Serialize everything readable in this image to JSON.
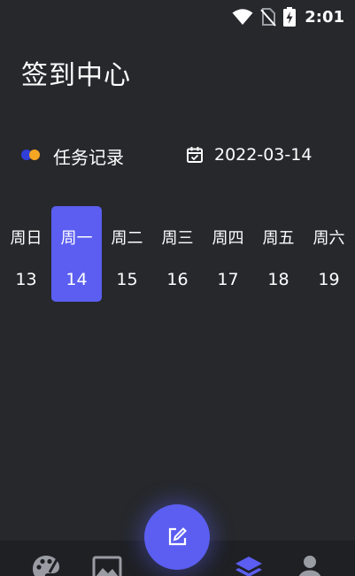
{
  "status_bar": {
    "time": "2:01",
    "icons": [
      "wifi-icon",
      "no-sim-icon",
      "battery-charging-icon"
    ]
  },
  "page": {
    "title": "签到中心"
  },
  "task_row": {
    "label": "任务记录",
    "icon": "dots-icon",
    "date_icon": "calendar-icon",
    "date": "2022-03-14"
  },
  "week": {
    "selected_index": 1,
    "days": [
      {
        "name": "周日",
        "date": "13"
      },
      {
        "name": "周一",
        "date": "14"
      },
      {
        "name": "周二",
        "date": "15"
      },
      {
        "name": "周三",
        "date": "16"
      },
      {
        "name": "周四",
        "date": "17"
      },
      {
        "name": "周五",
        "date": "18"
      },
      {
        "name": "周六",
        "date": "19"
      }
    ]
  },
  "fab": {
    "icon": "edit-icon"
  },
  "bottom_nav": {
    "items": [
      {
        "icon": "palette-icon",
        "active": false
      },
      {
        "icon": "image-icon",
        "active": false
      },
      {
        "icon": "layers-icon",
        "active": true
      },
      {
        "icon": "user-icon",
        "active": false
      }
    ]
  },
  "colors": {
    "background": "#26282c",
    "accent": "#5b5ef0",
    "nav_bar": "#1e2024",
    "dot_blue": "#2f3fd8",
    "dot_orange": "#f5a623",
    "icon_grey": "#9a9ca4"
  }
}
